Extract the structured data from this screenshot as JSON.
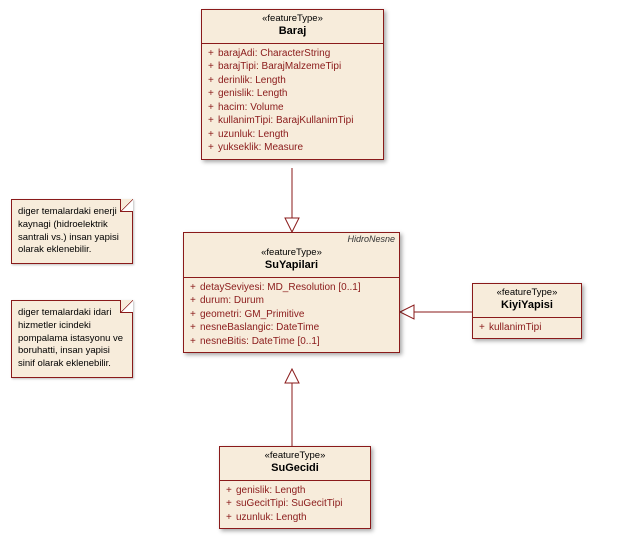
{
  "classes": {
    "baraj": {
      "stereo": "«featureType»",
      "name": "Baraj",
      "attrs": [
        "barajAdi: CharacterString",
        "barajTipi: BarajMalzemeTipi",
        "derinlik: Length",
        "genislik: Length",
        "hacim: Volume",
        "kullanimTipi: BarajKullanimTipi",
        "uzunluk: Length",
        "yukseklik: Measure"
      ]
    },
    "suyapilari": {
      "pkg": "HidroNesne",
      "stereo": "«featureType»",
      "name": "SuYapilari",
      "attrs": [
        "detaySeviyesi: MD_Resolution [0..1]",
        "durum: Durum",
        "geometri: GM_Primitive",
        "nesneBaslangic: DateTime",
        "nesneBitis: DateTime [0..1]"
      ]
    },
    "kiyiyapisi": {
      "stereo": "«featureType»",
      "name": "KiyiYapisi",
      "attrs": [
        "kullanimTipi"
      ]
    },
    "sugecidi": {
      "stereo": "«featureType»",
      "name": "SuGecidi",
      "attrs": [
        "genislik: Length",
        "suGecitTipi: SuGecitTipi",
        "uzunluk: Length"
      ]
    }
  },
  "notes": {
    "n1": "diger temalardaki enerji kaynagi (hidroelektrik santrali vs.) insan yapisi olarak eklenebilir.",
    "n2": "diger temalardaki idari hizmetler icindeki pompalama istasyonu ve boruhatti, insan yapisi sinif olarak eklenebilir."
  },
  "chart_data": {
    "type": "table",
    "description": "UML class diagram with one superclass SuYapilari and three subclasses Baraj, KiyiYapisi, SuGecidi (generalization arrows point from subclasses to SuYapilari). Two annotation notes at left.",
    "classes": [
      {
        "name": "Baraj",
        "stereotype": "featureType",
        "attributes": [
          {
            "name": "barajAdi",
            "type": "CharacterString",
            "visibility": "+"
          },
          {
            "name": "barajTipi",
            "type": "BarajMalzemeTipi",
            "visibility": "+"
          },
          {
            "name": "derinlik",
            "type": "Length",
            "visibility": "+"
          },
          {
            "name": "genislik",
            "type": "Length",
            "visibility": "+"
          },
          {
            "name": "hacim",
            "type": "Volume",
            "visibility": "+"
          },
          {
            "name": "kullanimTipi",
            "type": "BarajKullanimTipi",
            "visibility": "+"
          },
          {
            "name": "uzunluk",
            "type": "Length",
            "visibility": "+"
          },
          {
            "name": "yukseklik",
            "type": "Measure",
            "visibility": "+"
          }
        ]
      },
      {
        "name": "SuYapilari",
        "stereotype": "featureType",
        "package": "HidroNesne",
        "attributes": [
          {
            "name": "detaySeviyesi",
            "type": "MD_Resolution",
            "mult": "[0..1]",
            "visibility": "+"
          },
          {
            "name": "durum",
            "type": "Durum",
            "visibility": "+"
          },
          {
            "name": "geometri",
            "type": "GM_Primitive",
            "visibility": "+"
          },
          {
            "name": "nesneBaslangic",
            "type": "DateTime",
            "visibility": "+"
          },
          {
            "name": "nesneBitis",
            "type": "DateTime",
            "mult": "[0..1]",
            "visibility": "+"
          }
        ]
      },
      {
        "name": "KiyiYapisi",
        "stereotype": "featureType",
        "attributes": [
          {
            "name": "kullanimTipi",
            "type": "",
            "visibility": "+"
          }
        ]
      },
      {
        "name": "SuGecidi",
        "stereotype": "featureType",
        "attributes": [
          {
            "name": "genislik",
            "type": "Length",
            "visibility": "+"
          },
          {
            "name": "suGecitTipi",
            "type": "SuGecitTipi",
            "visibility": "+"
          },
          {
            "name": "uzunluk",
            "type": "Length",
            "visibility": "+"
          }
        ]
      }
    ],
    "generalizations": [
      {
        "child": "Baraj",
        "parent": "SuYapilari"
      },
      {
        "child": "KiyiYapisi",
        "parent": "SuYapilari"
      },
      {
        "child": "SuGecidi",
        "parent": "SuYapilari"
      }
    ],
    "notes": [
      "diger temalardaki enerji kaynagi (hidroelektrik santrali vs.) insan yapisi olarak eklenebilir.",
      "diger temalardaki idari hizmetler icindeki pompalama istasyonu ve boruhatti, insan yapisi sinif olarak eklenebilir."
    ]
  }
}
